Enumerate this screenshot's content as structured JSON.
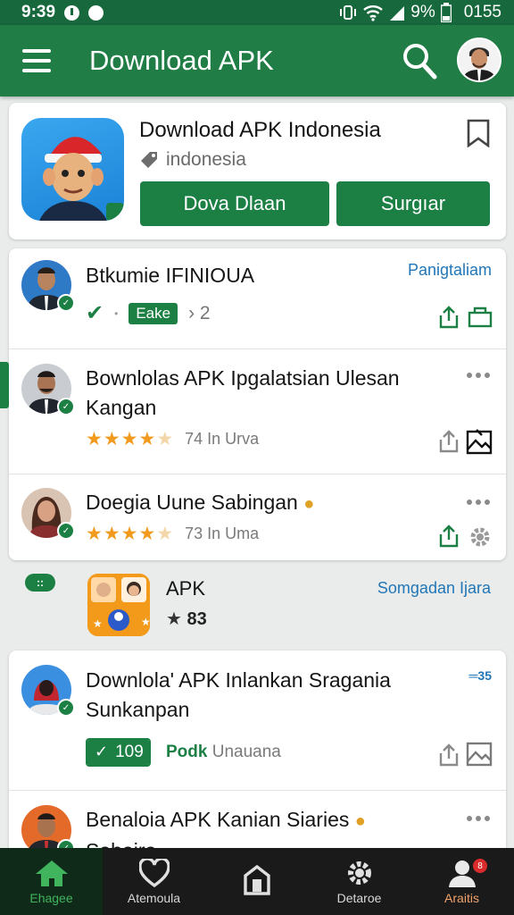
{
  "status_bar": {
    "time": "9:39",
    "battery": "9%",
    "clock_right": "0155"
  },
  "app_bar": {
    "title": "Download APK",
    "menu_icon": "hamburger-menu-icon",
    "search_icon": "search-icon",
    "avatar": "profile-avatar"
  },
  "featured": {
    "title": "Download APK Indonesia",
    "subtitle": "indonesia",
    "bookmark_icon": "bookmark-icon",
    "primary_button": "Dova Dlaan",
    "secondary_button": "Surgıar"
  },
  "list": [
    {
      "title": "Btkumie IFINIOUA",
      "link": "Panigtaliam",
      "pill": "Eake",
      "meta": "› 2"
    },
    {
      "title_line1": "Bownlolas APK Ipgalatsian Ulesan",
      "title_line2": "Kangan",
      "rating_text": "74 In Urva"
    },
    {
      "title": "Doegia Uune Sabingan",
      "rating_text": "73 In Uma"
    }
  ],
  "promo": {
    "chip": "::",
    "title": "APK",
    "rating": "83",
    "link": "Somgadan Ijara"
  },
  "list2": [
    {
      "title_line1": "Downlola' APK Inlankan Sragania",
      "title_line2": "Sunkanpan",
      "badge_count": "109",
      "source": "Podk",
      "source_sub": "Unauana",
      "corner_label": "35"
    },
    {
      "title": "Benaloia APK Kanian Siaries",
      "title_line2": "Sabeira"
    }
  ],
  "bottom_nav": [
    {
      "label": "Ehagee",
      "icon": "home-icon"
    },
    {
      "label": "Atemoula",
      "icon": "heart-icon"
    },
    {
      "label": "",
      "icon": "store-icon"
    },
    {
      "label": "Detaroe",
      "icon": "gear-icon"
    },
    {
      "label": "Araitis",
      "icon": "user-icon",
      "badge": "8"
    }
  ],
  "colors": {
    "primary": "#1f7d45",
    "accent_blue": "#2176b8",
    "star": "#f29a1d"
  }
}
